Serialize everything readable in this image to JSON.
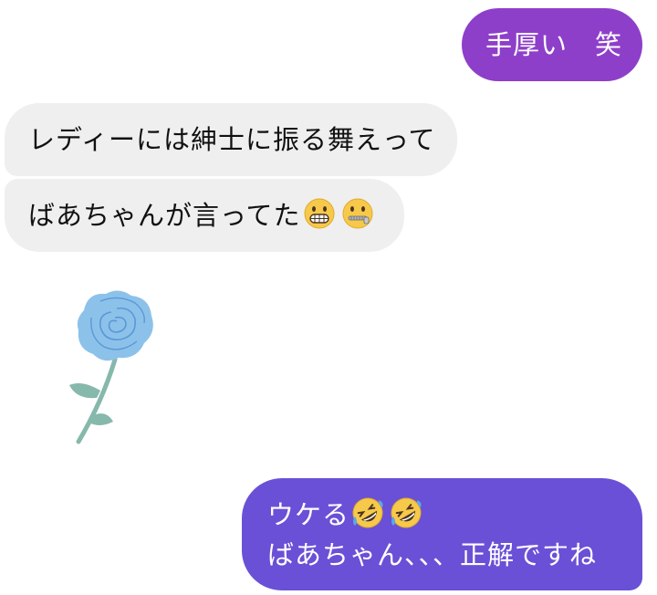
{
  "colors": {
    "outgoing_bubble_1": "#8e3fc9",
    "outgoing_bubble_2": "#6a50d6",
    "incoming_bubble": "#efefef",
    "rose_petal": "#8cc2ea",
    "rose_stem": "#86b8ab"
  },
  "messages": [
    {
      "direction": "outgoing",
      "text": "手厚い　笑"
    },
    {
      "direction": "incoming",
      "text": "レディーには紳士に振る舞えって"
    },
    {
      "direction": "incoming",
      "text": "ばあちゃんが言ってた",
      "emojis": [
        "grimacing-face",
        "zipper-mouth-face"
      ]
    },
    {
      "direction": "incoming",
      "sticker": "blue-rose-sticker"
    },
    {
      "direction": "outgoing",
      "line1": "ウケる",
      "line1_emojis": [
        "rolling-on-floor-laughing",
        "rolling-on-floor-laughing"
      ],
      "line2": "ばあちゃん、、、正解ですね"
    }
  ]
}
